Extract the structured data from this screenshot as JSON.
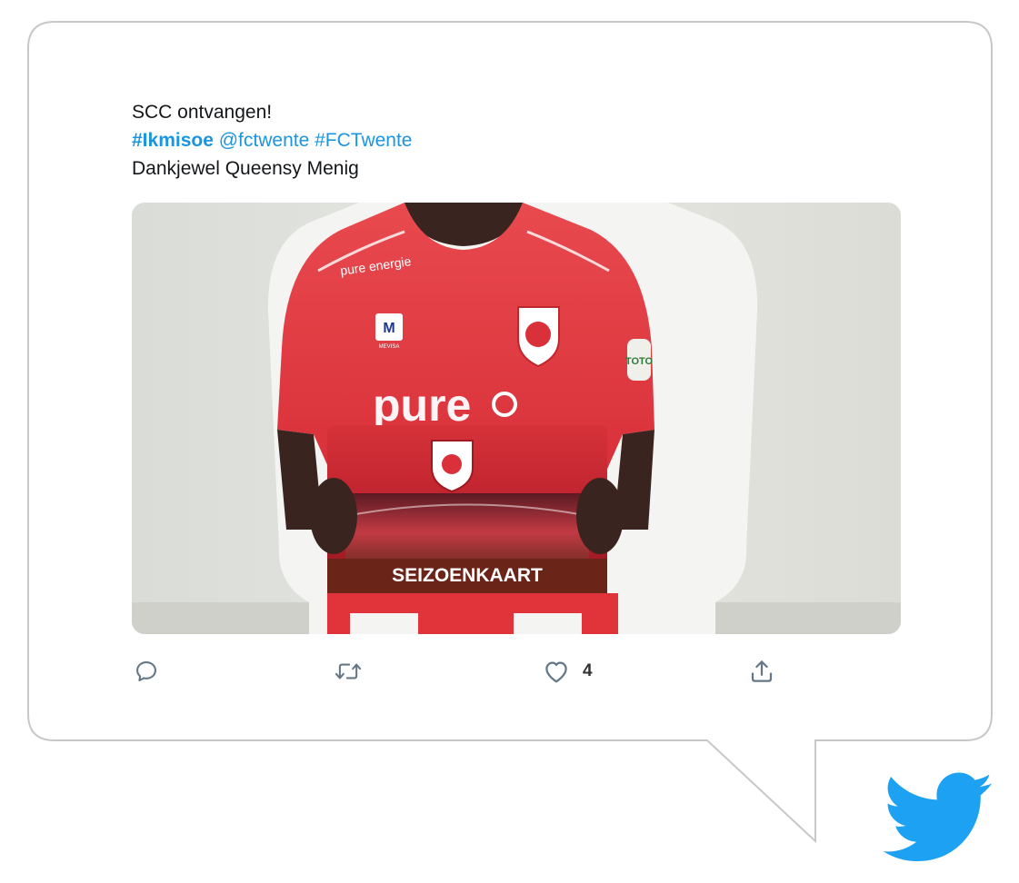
{
  "tweet": {
    "lines": [
      {
        "text": "SCC ontvangen!"
      },
      {
        "hashtag": "#Ikmisoe",
        "mention": "@fctwente",
        "tag2": "#FCTwente"
      },
      {
        "text": "Dankjewel Queensy Menig"
      }
    ],
    "photo": {
      "jersey_sponsor": "pure energie",
      "card_label": "SEIZOENKAART",
      "kit_brand": "MEVISA",
      "sleeve_badge": "TOTO"
    },
    "actions": {
      "reply_icon": "reply-icon",
      "retweet_icon": "retweet-icon",
      "like_icon": "heart-icon",
      "like_count": "4",
      "share_icon": "share-icon"
    }
  },
  "colors": {
    "link": "#1b95e0",
    "twitter_blue": "#1da1f2",
    "jersey_red": "#e0343a",
    "bubble_border": "#c8c8c8"
  }
}
